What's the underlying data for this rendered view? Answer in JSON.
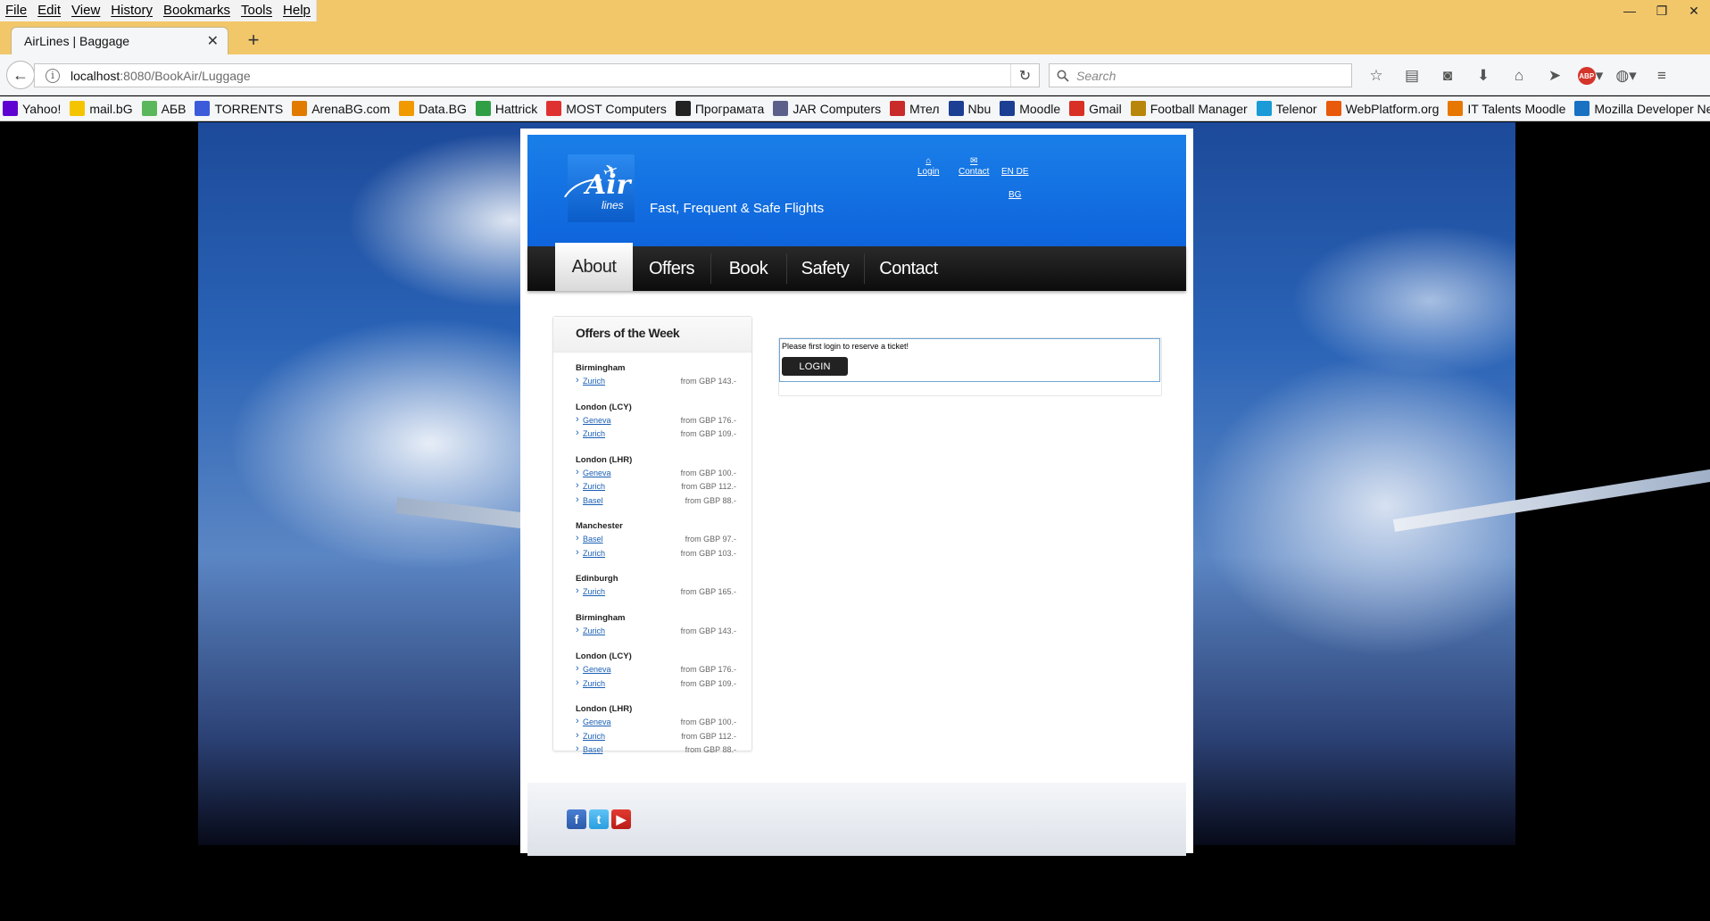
{
  "menubar": {
    "items": [
      "File",
      "Edit",
      "View",
      "History",
      "Bookmarks",
      "Tools",
      "Help"
    ]
  },
  "window_controls": {
    "minimize": "—",
    "restore": "❐",
    "close": "✕"
  },
  "tab": {
    "title": "AirLines | Baggage",
    "close": "✕",
    "new": "+"
  },
  "urlbar": {
    "host": "localhost",
    "path": ":8080/BookAir/Luggage"
  },
  "searchbar": {
    "placeholder": "Search"
  },
  "bookmarks": [
    {
      "label": "Yahoo!",
      "color": "#5f01d1"
    },
    {
      "label": "mail.bG",
      "color": "#f5c400"
    },
    {
      "label": "АБВ",
      "color": "#5bb75b"
    },
    {
      "label": "TORRENTS",
      "color": "#3b5bdb"
    },
    {
      "label": "ArenaBG.com",
      "color": "#e07b00"
    },
    {
      "label": "Data.BG",
      "color": "#f09a00"
    },
    {
      "label": "Hattrick",
      "color": "#2f9e44"
    },
    {
      "label": "MOST Computers",
      "color": "#e03131"
    },
    {
      "label": "Програмата",
      "color": "#222222"
    },
    {
      "label": "JAR Computers",
      "color": "#5c5f8a"
    },
    {
      "label": "Мтел",
      "color": "#c92a2a"
    },
    {
      "label": "Nbu",
      "color": "#1c3f94"
    },
    {
      "label": "Moodle",
      "color": "#1c3f94"
    },
    {
      "label": "Gmail",
      "color": "#d93025"
    },
    {
      "label": "Football Manager",
      "color": "#b8860b"
    },
    {
      "label": "Telenor",
      "color": "#1a9bd7"
    },
    {
      "label": "WebPlatform.org",
      "color": "#e8590c"
    },
    {
      "label": "IT Talents Moodle",
      "color": "#e67700"
    },
    {
      "label": "Mozilla Developer Net...",
      "color": "#1971c2"
    }
  ],
  "site": {
    "tagline": "Fast, Frequent & Safe Flights",
    "logo_main": "Air",
    "logo_sub": "lines",
    "header_links": {
      "login": "Login",
      "contact": "Contact",
      "lang1": "EN DE",
      "lang2": "BG"
    },
    "nav": [
      "About",
      "Offers",
      "Book",
      "Safety",
      "Contact"
    ],
    "sidebar": {
      "title": "Offers of the Week",
      "groups": [
        {
          "city": "Birmingham",
          "offers": [
            {
              "dest": "Zurich",
              "price": "from GBP 143.-"
            }
          ]
        },
        {
          "city": "London (LCY)",
          "offers": [
            {
              "dest": "Geneva",
              "price": "from GBP 176.-"
            },
            {
              "dest": "Zurich",
              "price": "from GBP 109.-"
            }
          ]
        },
        {
          "city": "London (LHR)",
          "offers": [
            {
              "dest": "Geneva",
              "price": "from GBP 100.-"
            },
            {
              "dest": "Zurich",
              "price": "from GBP 112.-"
            },
            {
              "dest": "Basel",
              "price": "from GBP 88.-"
            }
          ]
        },
        {
          "city": "Manchester",
          "offers": [
            {
              "dest": "Basel",
              "price": "from GBP 97.-"
            },
            {
              "dest": "Zurich",
              "price": "from GBP 103.-"
            }
          ]
        },
        {
          "city": "Edinburgh",
          "offers": [
            {
              "dest": "Zurich",
              "price": "from GBP 165.-"
            }
          ]
        },
        {
          "city": "Birmingham",
          "offers": [
            {
              "dest": "Zurich",
              "price": "from GBP 143.-"
            }
          ]
        },
        {
          "city": "London (LCY)",
          "offers": [
            {
              "dest": "Geneva",
              "price": "from GBP 176.-"
            },
            {
              "dest": "Zurich",
              "price": "from GBP 109.-"
            }
          ]
        },
        {
          "city": "London (LHR)",
          "offers": [
            {
              "dest": "Geneva",
              "price": "from GBP 100.-"
            },
            {
              "dest": "Zurich",
              "price": "from GBP 112.-"
            },
            {
              "dest": "Basel",
              "price": "from GBP 88.-"
            }
          ]
        }
      ]
    },
    "login_panel": {
      "message": "Please first login to reserve a ticket!",
      "button": "LOGIN"
    },
    "footer": {
      "social": [
        "facebook",
        "twitter",
        "youtube"
      ]
    }
  },
  "colors": {
    "header_blue": "#1a7fe8",
    "nav_dark": "#111111",
    "link": "#1a5fb4",
    "chrome_title": "#f1c76a"
  }
}
